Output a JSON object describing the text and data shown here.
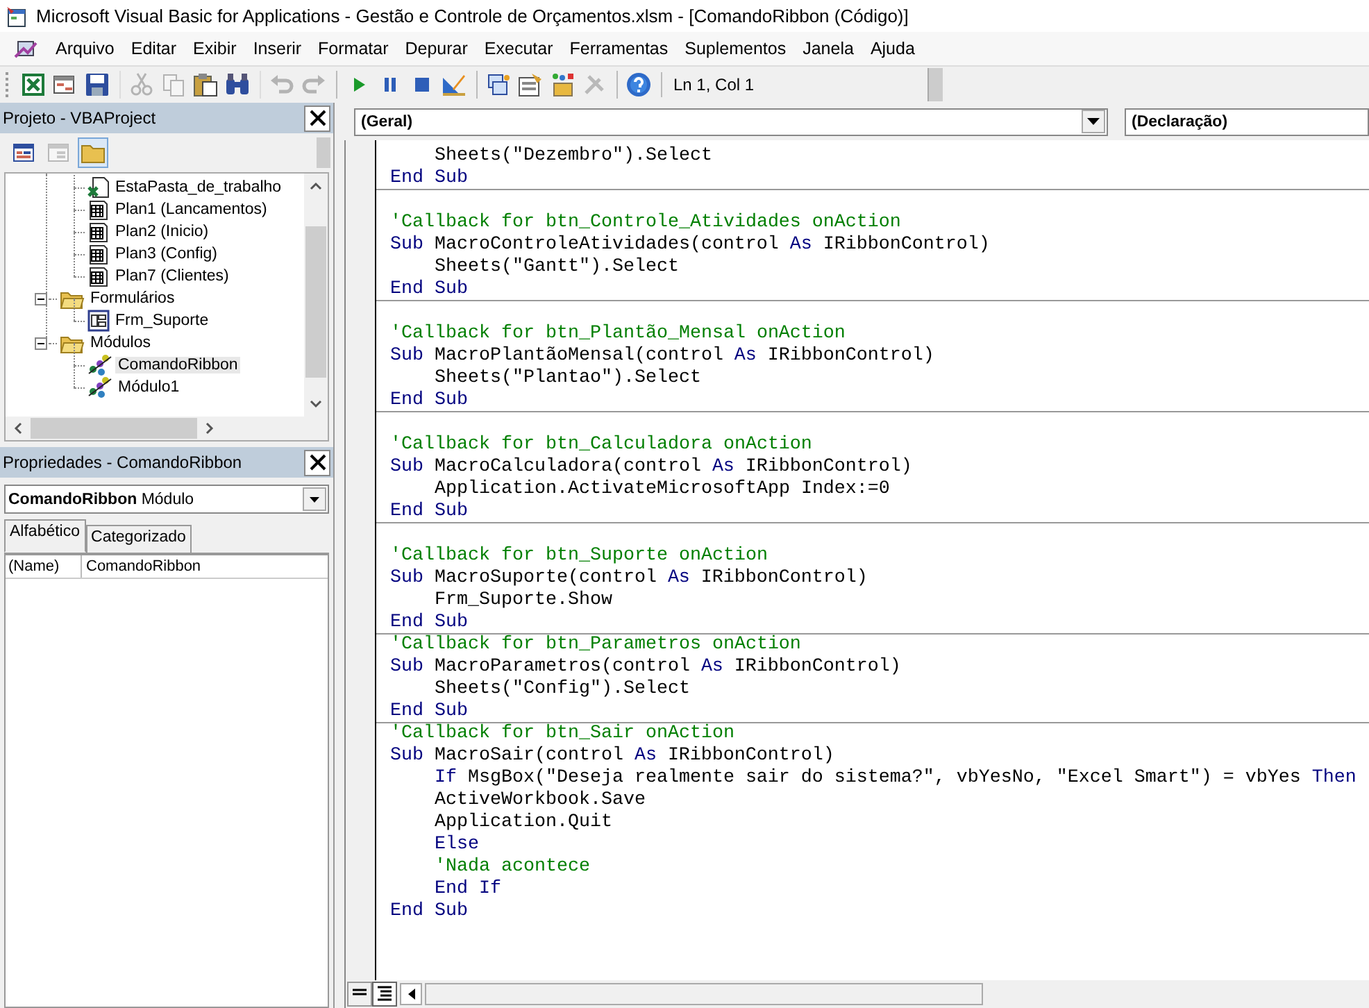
{
  "window": {
    "title": "Microsoft Visual Basic for Applications - Gestão e Controle de Orçamentos.xlsm - [ComandoRibbon (Código)]"
  },
  "menu": [
    {
      "label": "Arquivo"
    },
    {
      "label": "Editar"
    },
    {
      "label": "Exibir"
    },
    {
      "label": "Inserir"
    },
    {
      "label": "Formatar"
    },
    {
      "label": "Depurar"
    },
    {
      "label": "Executar"
    },
    {
      "label": "Ferramentas"
    },
    {
      "label": "Suplementos"
    },
    {
      "label": "Janela"
    },
    {
      "label": "Ajuda"
    }
  ],
  "toolbar": {
    "buttons": [
      {
        "kind": "excel",
        "disabled": false,
        "group_start": false
      },
      {
        "kind": "insert",
        "disabled": false,
        "group_start": false
      },
      {
        "kind": "save",
        "disabled": false,
        "group_start": false
      },
      {
        "kind": "cut",
        "disabled": true,
        "group_start": true
      },
      {
        "kind": "copy",
        "disabled": true,
        "group_start": false
      },
      {
        "kind": "paste",
        "disabled": false,
        "group_start": false
      },
      {
        "kind": "find",
        "disabled": false,
        "group_start": false
      },
      {
        "kind": "undo",
        "disabled": true,
        "group_start": true
      },
      {
        "kind": "redo",
        "disabled": true,
        "group_start": false
      },
      {
        "kind": "run",
        "disabled": false,
        "group_start": true
      },
      {
        "kind": "pause",
        "disabled": false,
        "group_start": false
      },
      {
        "kind": "stop",
        "disabled": false,
        "group_start": false
      },
      {
        "kind": "design",
        "disabled": false,
        "group_start": false
      },
      {
        "kind": "project",
        "disabled": false,
        "group_start": true
      },
      {
        "kind": "properties",
        "disabled": false,
        "group_start": false
      },
      {
        "kind": "objects",
        "disabled": false,
        "group_start": false
      },
      {
        "kind": "tools",
        "disabled": true,
        "group_start": false
      },
      {
        "kind": "help",
        "disabled": false,
        "group_start": true
      }
    ],
    "position": "Ln 1, Col 1"
  },
  "project": {
    "title": "Projeto - VBAProject",
    "buttons": [
      {
        "kind": "view-code",
        "disabled": false,
        "pressed": false
      },
      {
        "kind": "view-object",
        "disabled": true,
        "pressed": false
      },
      {
        "kind": "folders",
        "disabled": false,
        "pressed": true
      }
    ],
    "tree": {
      "continued_children": [
        {
          "label": "EstaPasta_de_trabalho",
          "kind": "workbook",
          "selected": false
        },
        {
          "label": "Plan1 (Lancamentos)",
          "kind": "sheet",
          "selected": false
        },
        {
          "label": "Plan2 (Inicio)",
          "kind": "sheet",
          "selected": false
        },
        {
          "label": "Plan3 (Config)",
          "kind": "sheet",
          "selected": false
        },
        {
          "label": "Plan7 (Clientes)",
          "kind": "sheet",
          "selected": false
        }
      ],
      "items": [
        {
          "label": "Formulários",
          "kind": "folder",
          "expanded": true,
          "selected": false,
          "children": [
            {
              "label": "Frm_Suporte",
              "kind": "form",
              "selected": false
            }
          ]
        },
        {
          "label": "Módulos",
          "kind": "folder",
          "expanded": true,
          "selected": false,
          "children": [
            {
              "label": "ComandoRibbon",
              "kind": "module",
              "selected": true
            },
            {
              "label": "Módulo1",
              "kind": "module",
              "selected": false
            }
          ]
        }
      ]
    }
  },
  "properties": {
    "title": "Propriedades - ComandoRibbon",
    "object_name": "ComandoRibbon",
    "object_type": "Módulo",
    "tabs": [
      {
        "label": "Alfabético",
        "selected": true
      },
      {
        "label": "Categorizado",
        "selected": false
      }
    ],
    "rows": [
      {
        "name": "(Name)",
        "value": "ComandoRibbon"
      }
    ]
  },
  "code": {
    "object_list": "(Geral)",
    "procedure_list": "(Declaração)",
    "blocks": [
      {
        "continued_body": [
          {
            "tokens": [
              {
                "t": "Sheets(\"Dezembro\").Select",
                "kind": "plain"
              }
            ]
          }
        ],
        "lines": [
          {
            "tokens": [
              {
                "t": "End Sub",
                "kind": "kw"
              }
            ]
          }
        ]
      },
      {
        "leading_blank": true,
        "lines": [
          {
            "tokens": [
              {
                "t": "'Callback for btn_Controle_Atividades onAction",
                "kind": "comment"
              }
            ]
          },
          {
            "tokens": [
              {
                "t": "Sub",
                "kind": "kw"
              },
              {
                "t": "MacroControleAtividades(control",
                "kind": "plain"
              },
              {
                "t": "As",
                "kind": "kw"
              },
              {
                "t": "IRibbonControl)",
                "kind": "plain"
              }
            ],
            "children": [
              {
                "tokens": [
                  {
                    "t": "Sheets(\"Gantt\").Select",
                    "kind": "plain"
                  }
                ]
              }
            ]
          },
          {
            "tokens": [
              {
                "t": "End Sub",
                "kind": "kw"
              }
            ]
          }
        ]
      },
      {
        "leading_blank": true,
        "lines": [
          {
            "tokens": [
              {
                "t": "'Callback for btn_Plantão_Mensal onAction",
                "kind": "comment"
              }
            ]
          },
          {
            "tokens": [
              {
                "t": "Sub",
                "kind": "kw"
              },
              {
                "t": "MacroPlantãoMensal(control",
                "kind": "plain"
              },
              {
                "t": "As",
                "kind": "kw"
              },
              {
                "t": "IRibbonControl)",
                "kind": "plain"
              }
            ],
            "children": [
              {
                "tokens": [
                  {
                    "t": "Sheets(\"Plantao\").Select",
                    "kind": "plain"
                  }
                ]
              }
            ]
          },
          {
            "tokens": [
              {
                "t": "End Sub",
                "kind": "kw"
              }
            ]
          }
        ]
      },
      {
        "leading_blank": true,
        "lines": [
          {
            "tokens": [
              {
                "t": "'Callback for btn_Calculadora onAction",
                "kind": "comment"
              }
            ]
          },
          {
            "tokens": [
              {
                "t": "Sub",
                "kind": "kw"
              },
              {
                "t": "MacroCalculadora(control",
                "kind": "plain"
              },
              {
                "t": "As",
                "kind": "kw"
              },
              {
                "t": "IRibbonControl)",
                "kind": "plain"
              }
            ],
            "children": [
              {
                "tokens": [
                  {
                    "t": "Application.ActivateMicrosoftApp Index:=0",
                    "kind": "plain"
                  }
                ]
              }
            ]
          },
          {
            "tokens": [
              {
                "t": "End Sub",
                "kind": "kw"
              }
            ]
          }
        ]
      },
      {
        "leading_blank": true,
        "lines": [
          {
            "tokens": [
              {
                "t": "'Callback for btn_Suporte onAction",
                "kind": "comment"
              }
            ]
          },
          {
            "tokens": [
              {
                "t": "Sub",
                "kind": "kw"
              },
              {
                "t": "MacroSuporte(control",
                "kind": "plain"
              },
              {
                "t": "As",
                "kind": "kw"
              },
              {
                "t": "IRibbonControl)",
                "kind": "plain"
              }
            ],
            "children": [
              {
                "tokens": [
                  {
                    "t": "Frm_Suporte.Show",
                    "kind": "plain"
                  }
                ]
              }
            ]
          },
          {
            "tokens": [
              {
                "t": "End Sub",
                "kind": "kw"
              }
            ]
          }
        ]
      },
      {
        "leading_blank": false,
        "lines": [
          {
            "tokens": [
              {
                "t": "'Callback for btn_Parametros onAction",
                "kind": "comment"
              }
            ]
          },
          {
            "tokens": [
              {
                "t": "Sub",
                "kind": "kw"
              },
              {
                "t": "MacroParametros(control",
                "kind": "plain"
              },
              {
                "t": "As",
                "kind": "kw"
              },
              {
                "t": "IRibbonControl)",
                "kind": "plain"
              }
            ],
            "children": [
              {
                "tokens": [
                  {
                    "t": "Sheets(\"Config\").Select",
                    "kind": "plain"
                  }
                ]
              }
            ]
          },
          {
            "tokens": [
              {
                "t": "End Sub",
                "kind": "kw"
              }
            ]
          }
        ]
      },
      {
        "leading_blank": false,
        "lines": [
          {
            "tokens": [
              {
                "t": "'Callback for btn_Sair onAction",
                "kind": "comment"
              }
            ]
          },
          {
            "tokens": [
              {
                "t": "Sub",
                "kind": "kw"
              },
              {
                "t": "MacroSair(control",
                "kind": "plain"
              },
              {
                "t": "As",
                "kind": "kw"
              },
              {
                "t": "IRibbonControl)",
                "kind": "plain"
              }
            ],
            "children": [
              {
                "tokens": [
                  {
                    "t": "If",
                    "kind": "kw"
                  },
                  {
                    "t": "MsgBox(\"Deseja realmente sair do sistema?\", vbYesNo, \"Excel Smart\") = vbYes",
                    "kind": "plain"
                  },
                  {
                    "t": "Then",
                    "kind": "kw"
                  }
                ]
              },
              {
                "tokens": [
                  {
                    "t": "ActiveWorkbook.Save",
                    "kind": "plain"
                  }
                ]
              },
              {
                "tokens": [
                  {
                    "t": "Application.Quit",
                    "kind": "plain"
                  }
                ]
              },
              {
                "tokens": [
                  {
                    "t": "Else",
                    "kind": "kw"
                  }
                ]
              },
              {
                "tokens": [
                  {
                    "t": "'Nada acontece",
                    "kind": "comment"
                  }
                ]
              },
              {
                "tokens": [
                  {
                    "t": "End If",
                    "kind": "kw"
                  }
                ]
              }
            ]
          },
          {
            "tokens": [
              {
                "t": "End Sub",
                "kind": "kw"
              }
            ]
          }
        ]
      }
    ]
  }
}
